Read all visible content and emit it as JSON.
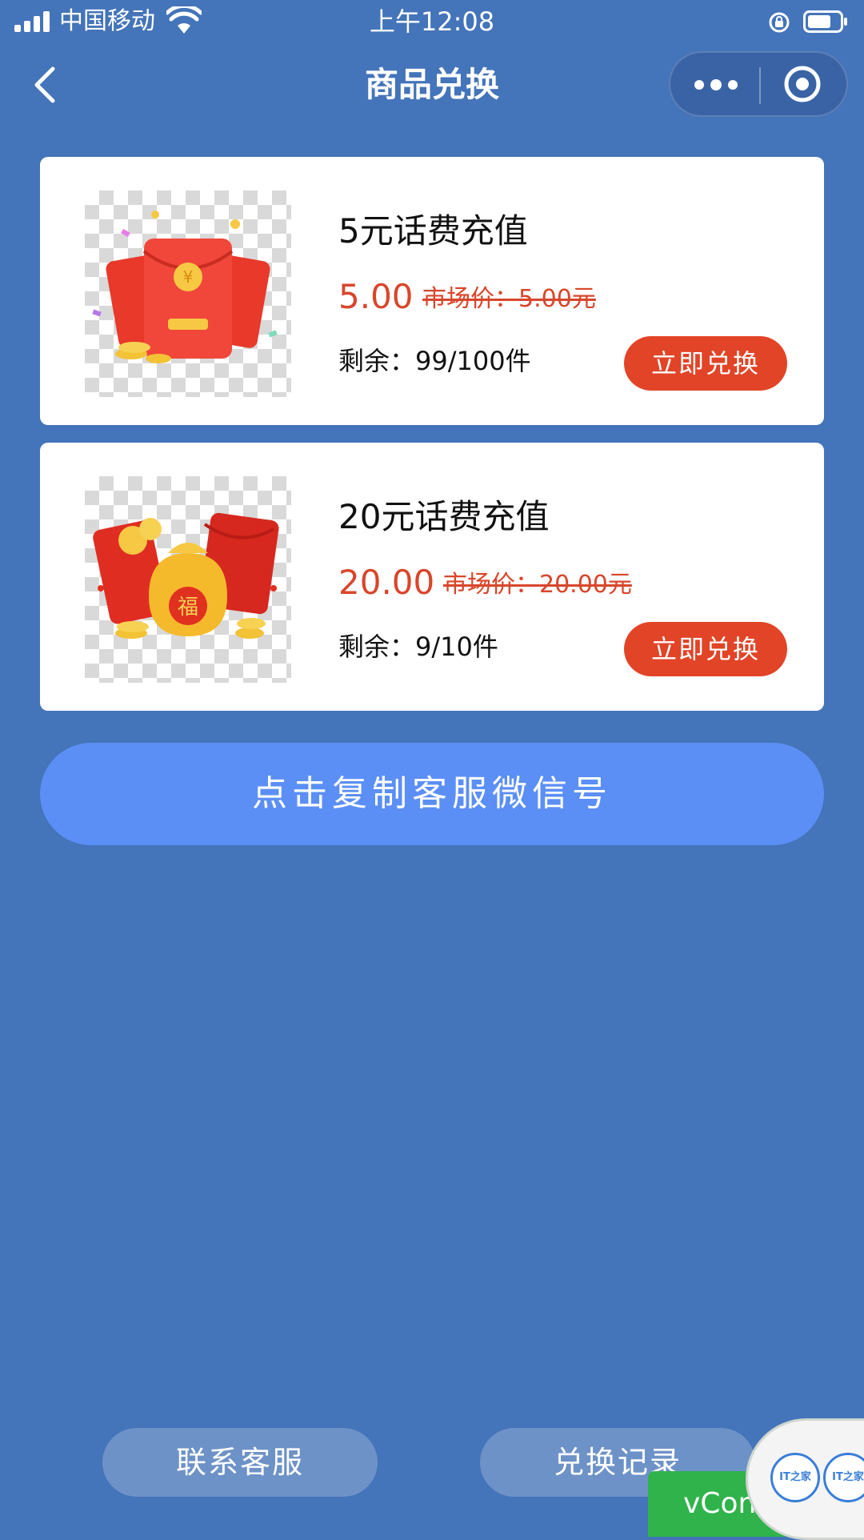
{
  "status_bar": {
    "carrier": "中国移动",
    "time": "上午12:08"
  },
  "nav": {
    "title": "商品兑换"
  },
  "products": [
    {
      "name": "5元话费充值",
      "price": "5.00",
      "market_price": "市场价：5.00元",
      "stock_label": "剩余：",
      "stock_value": "99/100件",
      "button": "立即兑换",
      "image": "red-envelope-coins-icon"
    },
    {
      "name": "20元话费充值",
      "price": "20.00",
      "market_price": "市场价：20.00元",
      "stock_label": "剩余：",
      "stock_value": "9/10件",
      "button": "立即兑换",
      "image": "fortune-bag-red-envelope-icon"
    }
  ],
  "copy_wechat_button": "点击复制客服微信号",
  "bottom": {
    "contact_button": "联系客服",
    "records_button": "兑换记录"
  },
  "vconsole_label": "vCons",
  "floating_logo_text": "IT之家",
  "colors": {
    "background": "#4474b9",
    "price": "#d9462b",
    "redeem_button": "#e24427",
    "wechat_button": "#5b8ff6",
    "vconsole": "#2fb34a"
  }
}
